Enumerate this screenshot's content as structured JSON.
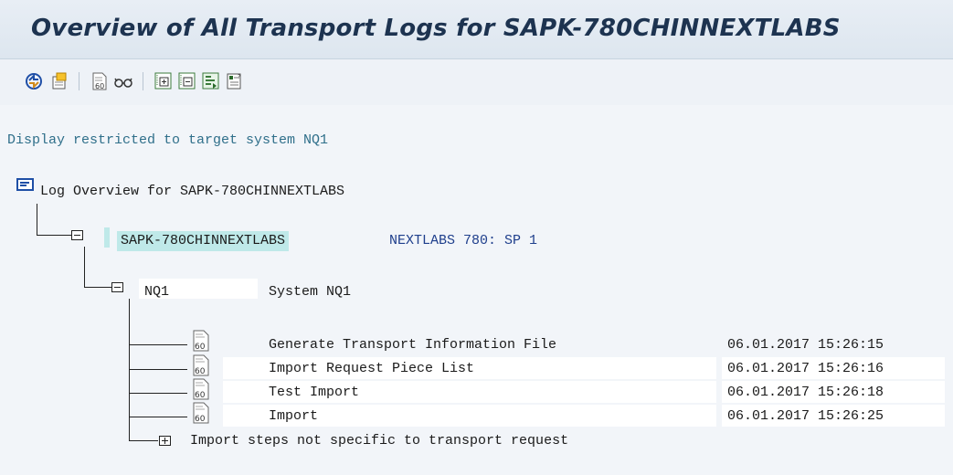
{
  "header": {
    "title": "Overview of All Transport Logs for SAPK-780CHINNEXTLABS"
  },
  "toolbar": {
    "buttons": [
      {
        "icon": "refresh-icon"
      },
      {
        "icon": "export-icon"
      },
      {
        "icon": "display-log-icon"
      },
      {
        "icon": "glasses-icon"
      },
      {
        "icon": "expand-icon"
      },
      {
        "icon": "collapse-icon"
      },
      {
        "icon": "expand-subtree-icon"
      },
      {
        "icon": "legend-icon"
      }
    ]
  },
  "main": {
    "restriction_note": "Display restricted to target system NQ1",
    "root_label": "Log Overview for SAPK-780CHINNEXTLABS",
    "request": {
      "name": "SAPK-780CHINNEXTLABS",
      "description": "NEXTLABS 780: SP 1"
    },
    "system": {
      "name": "NQ1",
      "description": "System NQ1"
    },
    "steps": [
      {
        "label": "Generate Transport Information File",
        "timestamp": "06.01.2017 15:26:15"
      },
      {
        "label": "Import Request Piece List",
        "timestamp": "06.01.2017 15:26:16"
      },
      {
        "label": "Test Import",
        "timestamp": "06.01.2017 15:26:18"
      },
      {
        "label": "Import",
        "timestamp": "06.01.2017 15:26:25"
      }
    ],
    "other_steps_label": "Import steps not specific to transport request"
  },
  "colors": {
    "title": "#1d3350",
    "restriction": "#2f6f8a",
    "request_desc": "#1f3f8c",
    "selection": "#bfe9e9"
  }
}
